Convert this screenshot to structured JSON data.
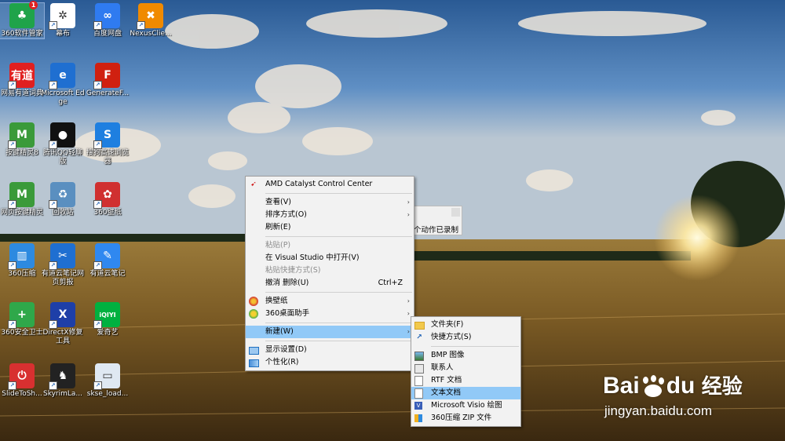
{
  "desktop": {
    "icons": [
      {
        "label": "360软件管家",
        "name": "icon-360-software-manager",
        "color": "#1fa34a",
        "glyph": "♣",
        "badge": "1"
      },
      {
        "label": "幕布",
        "name": "icon-mubu",
        "color": "#ffffff",
        "glyph": "✲"
      },
      {
        "label": "百度网盘",
        "name": "icon-baidu-netdisk",
        "color": "#2f7bf0",
        "glyph": "∞"
      },
      {
        "label": "NexusClie...",
        "name": "icon-nexus-client",
        "color": "#f08a00",
        "glyph": "✖"
      },
      {
        "label": "网易有道词典",
        "name": "icon-youdao-dict",
        "color": "#e02020",
        "glyph": "有道"
      },
      {
        "label": "Microsoft Edge",
        "name": "icon-ms-edge",
        "color": "#1f6fd1",
        "glyph": "e"
      },
      {
        "label": "GenerateF...",
        "name": "icon-generatef",
        "color": "#d02010",
        "glyph": "F"
      },
      {
        "label": "按键精灵8",
        "name": "icon-anjian-jingling-8",
        "color": "#3a9a3a",
        "glyph": "M"
      },
      {
        "label": "腾讯QQ轻聊版",
        "name": "icon-qq-lite",
        "color": "#111111",
        "glyph": "●"
      },
      {
        "label": "搜狗高速浏览器",
        "name": "icon-sogou-browser",
        "color": "#1e7fe0",
        "glyph": "S"
      },
      {
        "label": "网页按键精灵",
        "name": "icon-web-anjian",
        "color": "#3a9a3a",
        "glyph": "M"
      },
      {
        "label": "回收站",
        "name": "icon-recycle-bin",
        "color": "#5a8fc0",
        "glyph": "♻"
      },
      {
        "label": "360壁纸",
        "name": "icon-360-wallpaper",
        "color": "#d03030",
        "glyph": "✿"
      },
      {
        "label": "360压缩",
        "name": "icon-360-zip",
        "color": "#2d8ae0",
        "glyph": "▥"
      },
      {
        "label": "有道云笔记网页剪报",
        "name": "icon-youdao-clipper",
        "color": "#1f6fd1",
        "glyph": "✂"
      },
      {
        "label": "有道云笔记",
        "name": "icon-youdao-note",
        "color": "#2f88f0",
        "glyph": "✎"
      },
      {
        "label": "360安全卫士",
        "name": "icon-360-safe",
        "color": "#2fa84a",
        "glyph": "+"
      },
      {
        "label": "DirectX修复工具",
        "name": "icon-directx-repair",
        "color": "#1e3fa8",
        "glyph": "X"
      },
      {
        "label": "爱奇艺",
        "name": "icon-iqiyi",
        "color": "#00b140",
        "glyph": "iQIYI"
      },
      {
        "label": "SlideToSh...",
        "name": "icon-slide-to-shutdown",
        "color": "#d83030",
        "glyph": "⏻"
      },
      {
        "label": "SkyrimLa...",
        "name": "icon-skyrim-launcher",
        "color": "#222222",
        "glyph": "♞"
      },
      {
        "label": "skse_load...",
        "name": "icon-skse-loader",
        "color": "#dfe8f2",
        "glyph": "▭"
      }
    ]
  },
  "tooltip": {
    "text": "个动作已录制"
  },
  "context_menu": {
    "header": "AMD Catalyst Control Center",
    "view": "查看(V)",
    "sort": "排序方式(O)",
    "refresh": "刷新(E)",
    "paste": "粘贴(P)",
    "open_vs": "在 Visual Studio 中打开(V)",
    "paste_shortcut": "粘贴快捷方式(S)",
    "undo_delete": "撤消 删除(U)",
    "undo_shortcut": "Ctrl+Z",
    "change_wallpaper": "换壁纸",
    "desktop_assistant": "360桌面助手",
    "new": "新建(W)",
    "display_settings": "显示设置(D)",
    "personalize": "个性化(R)"
  },
  "submenu_new": {
    "folder": "文件夹(F)",
    "shortcut": "快捷方式(S)",
    "bmp": "BMP 图像",
    "contact": "联系人",
    "rtf": "RTF 文档",
    "text": "文本文档",
    "visio": "Microsoft Visio 绘图",
    "zip": "360压缩 ZIP 文件"
  },
  "watermark": {
    "brand": "Bai",
    "brand2": "du",
    "cn": "经验",
    "url": "jingyan.baidu.com"
  }
}
